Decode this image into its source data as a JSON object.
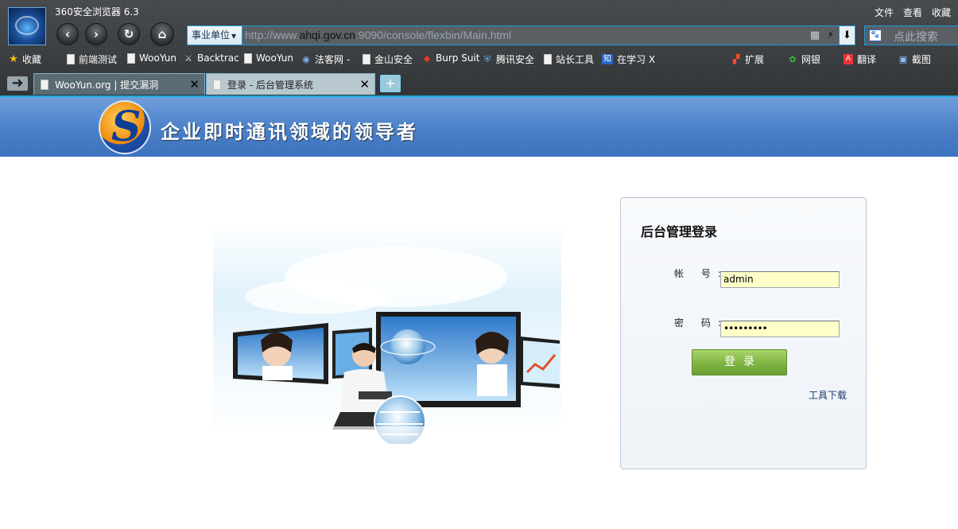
{
  "browser": {
    "title": "360安全浏览器 6.3",
    "menu": [
      "文件",
      "查看",
      "收藏"
    ],
    "address": {
      "dropdown": "事业单位",
      "url_prefix": "http://www.",
      "url_host": "ahqi.gov.cn",
      "url_rest": ":9090/console/flexbin/Main.html"
    },
    "search_placeholder": "点此搜索",
    "bookmarks": [
      {
        "label": "收藏",
        "icon": "star-icon"
      },
      {
        "label": "前端测试",
        "icon": "page-icon"
      },
      {
        "label": "WooYun",
        "icon": "page-icon"
      },
      {
        "label": "Backtrac",
        "icon": "knife-icon"
      },
      {
        "label": "WooYun",
        "icon": "page-icon"
      },
      {
        "label": "法客网 -",
        "icon": "globe-icon"
      },
      {
        "label": "金山安全",
        "icon": "page-icon"
      },
      {
        "label": "Burp Suit",
        "icon": "burp-icon"
      },
      {
        "label": "腾讯安全",
        "icon": "shield-icon"
      },
      {
        "label": "站长工具",
        "icon": "page-icon"
      },
      {
        "label": "在学习 X",
        "icon": "zhi-icon"
      }
    ],
    "right_tools": [
      {
        "label": "扩展",
        "icon": "extension-icon"
      },
      {
        "label": "网银",
        "icon": "bank-icon"
      },
      {
        "label": "翻译",
        "icon": "translate-icon"
      },
      {
        "label": "截图",
        "icon": "screenshot-icon"
      }
    ],
    "tabs": [
      {
        "label": "WooYun.org | 提交漏洞",
        "active": false
      },
      {
        "label": "登录 - 后台管理系统",
        "active": true
      }
    ]
  },
  "page": {
    "banner_slogan": "企业即时通讯领域的领导者",
    "login": {
      "title": "后台管理登录",
      "account_label": "帐 号:",
      "account_value": "admin",
      "password_label": "密 码:",
      "password_value": "•••••••••",
      "submit_label": "登录",
      "download_link": "工具下载"
    }
  }
}
